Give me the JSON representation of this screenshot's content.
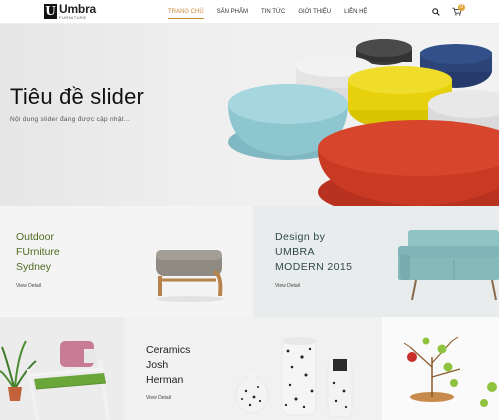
{
  "header": {
    "logo_name": "Umbra",
    "logo_sub": "FURNITURE",
    "logo_mark": "U",
    "nav": [
      {
        "label": "TRANG CHỦ",
        "active": true
      },
      {
        "label": "SẢN PHẨM",
        "active": false
      },
      {
        "label": "TIN TỨC",
        "active": false
      },
      {
        "label": "GIỚI THIỆU",
        "active": false
      },
      {
        "label": "LIÊN HỆ",
        "active": false
      }
    ],
    "search_icon": "search-icon",
    "cart_icon": "cart-icon",
    "cart_count": "0",
    "accent": "#c8883a"
  },
  "hero": {
    "title": "Tiêu đề slider",
    "subtitle": "Nội dung slider đang được cập nhật..."
  },
  "tiles": [
    {
      "lines": [
        "Outdoor",
        "FUrniture",
        "Sydney"
      ],
      "link": "View Detail",
      "color": "#4d6b1f"
    },
    {
      "lines": [
        "Design by",
        "UMBRA",
        "MODERN 2015"
      ],
      "link": "View Detail",
      "color": "#2e4a48"
    },
    {
      "lines": [
        "Ceramics",
        "Josh",
        "Herman"
      ],
      "link": "View Detail",
      "color": "#222222"
    }
  ]
}
